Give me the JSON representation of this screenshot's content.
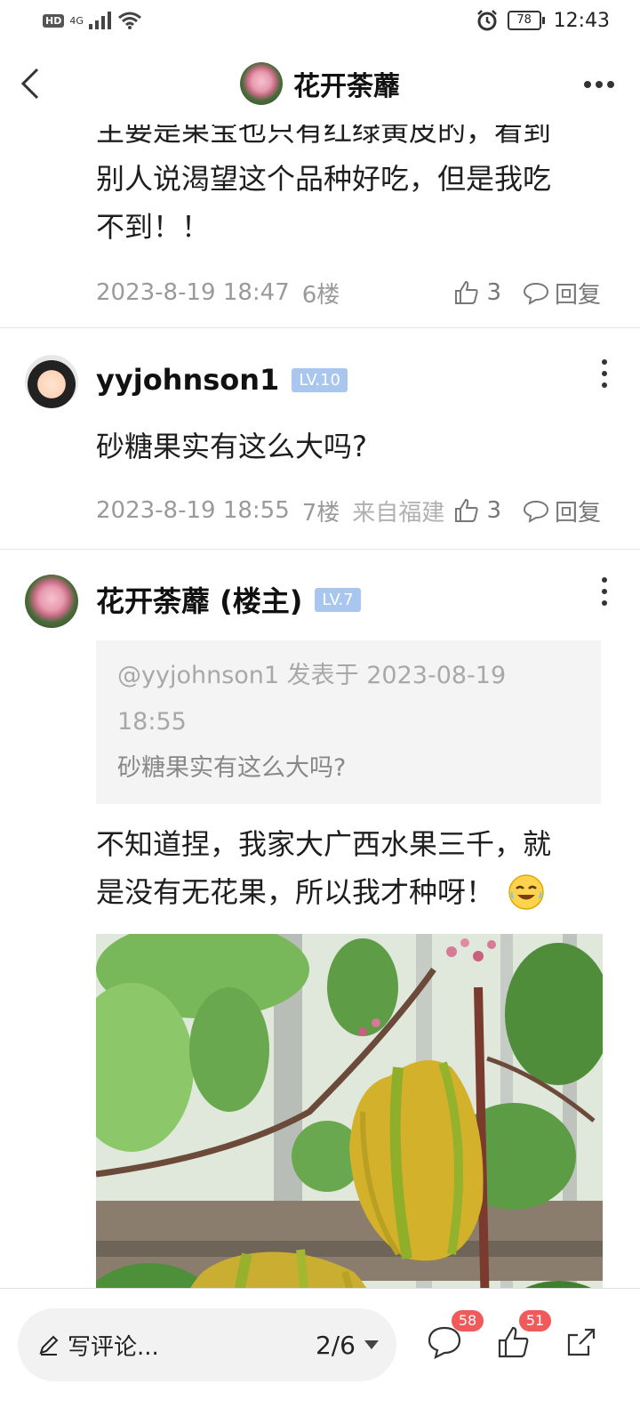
{
  "status_bar": {
    "hd": "HD",
    "network": "4G",
    "battery": "78",
    "time": "12:43"
  },
  "nav": {
    "title": "花开荼蘼"
  },
  "colors": {
    "accent_badge": "#a8c6ee",
    "notify_badge": "#f15a5a",
    "meta_gray": "#9a9a9a"
  },
  "posts": [
    {
      "body_lines": [
        "主要是果宝也只有红绿黄皮的，看到",
        "别人说渴望这个品种好吃，但是我吃",
        "不到！！"
      ],
      "date": "2023-8-19 18:47",
      "floor": "6楼",
      "likes": "3",
      "reply_label": "回复"
    },
    {
      "author": "yyjohnson1",
      "level": "LV.10",
      "body": "砂糖果实有这么大吗?",
      "date": "2023-8-19 18:55",
      "floor": "7楼",
      "location": "来自福建",
      "likes": "3",
      "reply_label": "回复"
    },
    {
      "author": "花开荼蘼 (楼主)",
      "level": "LV.7",
      "quote_header": "@yyjohnson1 发表于 2023-08-19 18:55",
      "quote_text": "砂糖果实有这么大吗?",
      "body_lines": [
        "不知道捏，我家大广西水果三千，就",
        "是没有无花果，所以我才种呀！"
      ],
      "emoji": "crying-laughing-emoji"
    }
  ],
  "bottom_bar": {
    "write_label": "写评论...",
    "page_indicator": "2/6",
    "comment_count": "58",
    "like_count": "51"
  }
}
